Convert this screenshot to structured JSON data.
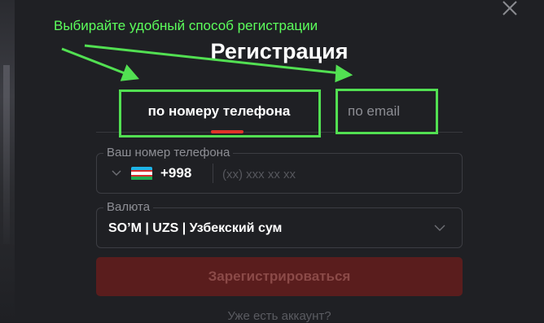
{
  "annotation": {
    "caption": "Выбирайте удобный способ регистрации",
    "color": "#52e052"
  },
  "modal": {
    "title": "Регистрация",
    "close_icon": "close-icon",
    "tabs": [
      {
        "label": "по номеру телефона",
        "active": true
      },
      {
        "label": "по email",
        "active": false
      }
    ],
    "phone_field": {
      "label": "Ваш номер телефона",
      "country_flag": "uzbekistan-flag-icon",
      "dial_code": "+998",
      "placeholder": "(xx) xxx xx xx",
      "value": ""
    },
    "currency_field": {
      "label": "Валюта",
      "value": "SO’M | UZS | Узбекский сум"
    },
    "submit_label": "Зарегистрироваться",
    "login_prompt": "Уже есть аккаунт?"
  },
  "colors": {
    "accent": "#e03328",
    "background": "#1f2024",
    "submit_disabled": "#5a1d1d"
  }
}
